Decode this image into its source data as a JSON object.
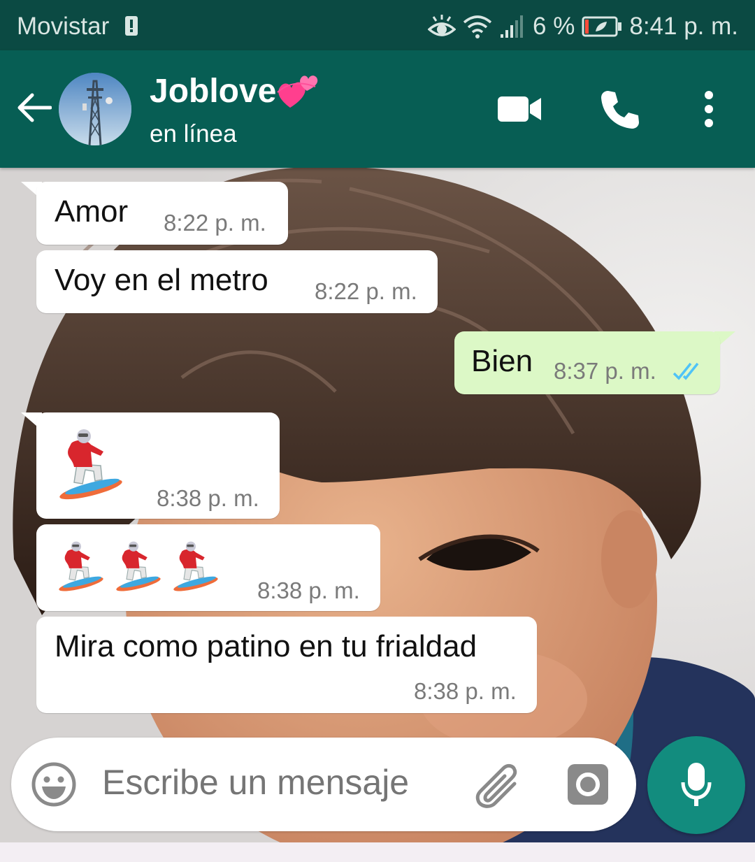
{
  "status_bar": {
    "carrier": "Movistar",
    "battery_percent": "6 %",
    "time": "8:41 p. m.",
    "icons": [
      "sim-icon",
      "eye-icon",
      "wifi-icon",
      "signal-icon",
      "battery-icon"
    ]
  },
  "header": {
    "contact_name": "Joblove",
    "name_emoji": "💞",
    "status": "en línea",
    "icons": [
      "back-arrow-icon",
      "video-call-icon",
      "phone-icon",
      "more-options-icon"
    ]
  },
  "messages": [
    {
      "direction": "incoming",
      "text": "Amor",
      "time": "8:22 p. m."
    },
    {
      "direction": "incoming",
      "text": "Voy en el metro",
      "time": "8:22 p. m."
    },
    {
      "direction": "outgoing",
      "text": "Bien",
      "time": "8:37 p. m.",
      "status": "read-double-check"
    },
    {
      "direction": "incoming",
      "sticker": "snowboarder-emoji",
      "count": 1,
      "time": "8:38 p. m."
    },
    {
      "direction": "incoming",
      "sticker": "snowboarder-emoji",
      "count": 3,
      "time": "8:38 p. m."
    },
    {
      "direction": "incoming",
      "text": "Mira como patino en tu frialdad",
      "time": "8:38 p. m."
    }
  ],
  "composer": {
    "placeholder": "Escribe un mensaje",
    "icons": [
      "emoji-icon",
      "attach-icon",
      "camera-icon",
      "mic-icon"
    ]
  },
  "colors": {
    "status_bar": "#0b4a43",
    "header": "#075e54",
    "outgoing_bubble": "#dcf8c6",
    "incoming_bubble": "#ffffff",
    "accent": "#128c7e",
    "read_tick": "#4fc3f7"
  }
}
